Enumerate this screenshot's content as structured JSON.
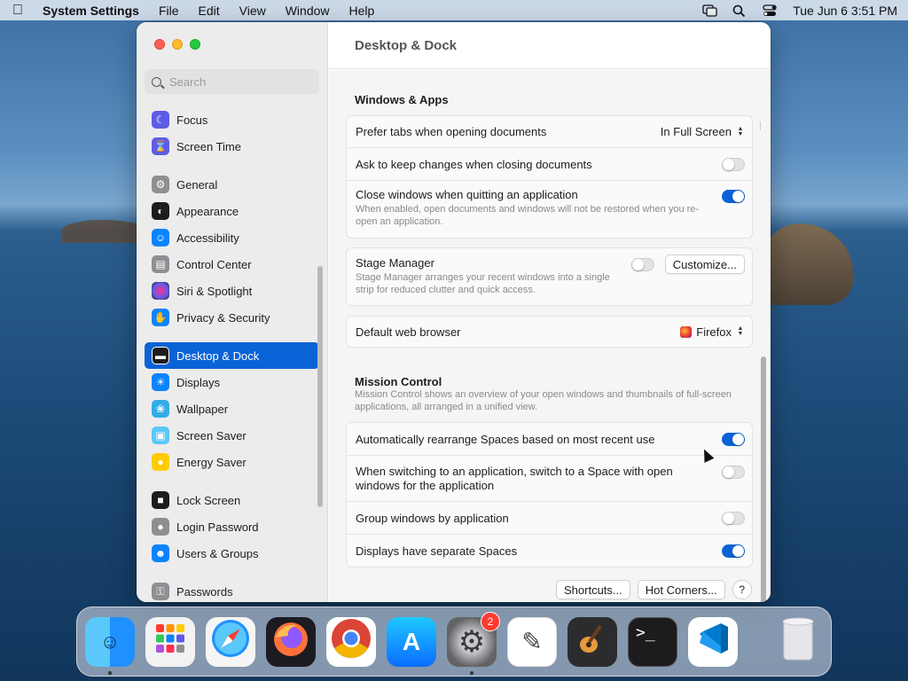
{
  "menubar": {
    "app_name": "System Settings",
    "menus": [
      "File",
      "Edit",
      "View",
      "Window",
      "Help"
    ],
    "clock": "Tue Jun 6  3:51 PM"
  },
  "window": {
    "title": "Desktop & Dock",
    "search_placeholder": "Search"
  },
  "sidebar": {
    "items": [
      {
        "label": "Focus",
        "icon": "moon-icon",
        "color": "#5e5ce6"
      },
      {
        "label": "Screen Time",
        "icon": "hourglass-icon",
        "color": "#5e5ce6"
      },
      {
        "label": "General",
        "icon": "gear-icon",
        "color": "#8e8e93"
      },
      {
        "label": "Appearance",
        "icon": "appearance-icon",
        "color": "#1d1d1f"
      },
      {
        "label": "Accessibility",
        "icon": "accessibility-icon",
        "color": "#0a84ff"
      },
      {
        "label": "Control Center",
        "icon": "control-center-icon",
        "color": "#8e8e93"
      },
      {
        "label": "Siri & Spotlight",
        "icon": "siri-icon",
        "color": "#bf5af2"
      },
      {
        "label": "Privacy & Security",
        "icon": "hand-icon",
        "color": "#0a84ff"
      },
      {
        "label": "Desktop & Dock",
        "icon": "dock-icon",
        "color": "#1d1d1f"
      },
      {
        "label": "Displays",
        "icon": "sun-icon",
        "color": "#0a84ff"
      },
      {
        "label": "Wallpaper",
        "icon": "flower-icon",
        "color": "#32ade6"
      },
      {
        "label": "Screen Saver",
        "icon": "screen-saver-icon",
        "color": "#5ac8fa"
      },
      {
        "label": "Energy Saver",
        "icon": "bulb-icon",
        "color": "#ffcc00"
      },
      {
        "label": "Lock Screen",
        "icon": "lock-screen-icon",
        "color": "#1d1d1f"
      },
      {
        "label": "Login Password",
        "icon": "lock-icon",
        "color": "#8e8e93"
      },
      {
        "label": "Users & Groups",
        "icon": "users-icon",
        "color": "#0a84ff"
      },
      {
        "label": "Passwords",
        "icon": "key-icon",
        "color": "#8e8e93"
      }
    ],
    "selected": "Desktop & Dock"
  },
  "windows_apps": {
    "title": "Windows & Apps",
    "prefer_tabs_label": "Prefer tabs when opening documents",
    "prefer_tabs_value": "In Full Screen",
    "ask_keep_label": "Ask to keep changes when closing documents",
    "ask_keep_on": false,
    "close_windows_label": "Close windows when quitting an application",
    "close_windows_desc": "When enabled, open documents and windows will not be restored when you re-open an application.",
    "close_windows_on": true
  },
  "stage_manager": {
    "label": "Stage Manager",
    "desc": "Stage Manager arranges your recent windows into a single strip for reduced clutter and quick access.",
    "on": false,
    "customize_label": "Customize..."
  },
  "browser": {
    "label": "Default web browser",
    "value": "Firefox"
  },
  "mission_control": {
    "title": "Mission Control",
    "desc": "Mission Control shows an overview of your open windows and thumbnails of full-screen applications, all arranged in a unified view.",
    "rows": [
      {
        "label": "Automatically rearrange Spaces based on most recent use",
        "on": true
      },
      {
        "label": "When switching to an application, switch to a Space with open windows for the application",
        "on": false
      },
      {
        "label": "Group windows by application",
        "on": false
      },
      {
        "label": "Displays have separate Spaces",
        "on": true
      }
    ]
  },
  "footer": {
    "shortcuts_label": "Shortcuts...",
    "hot_corners_label": "Hot Corners...",
    "help_label": "?"
  },
  "dock": {
    "apps": [
      "Finder",
      "Launchpad",
      "Safari",
      "Firefox",
      "Chrome",
      "App Store",
      "System Settings",
      "TextEdit",
      "GarageBand",
      "Terminal",
      "VS Code"
    ],
    "system_settings_badge": "2"
  }
}
